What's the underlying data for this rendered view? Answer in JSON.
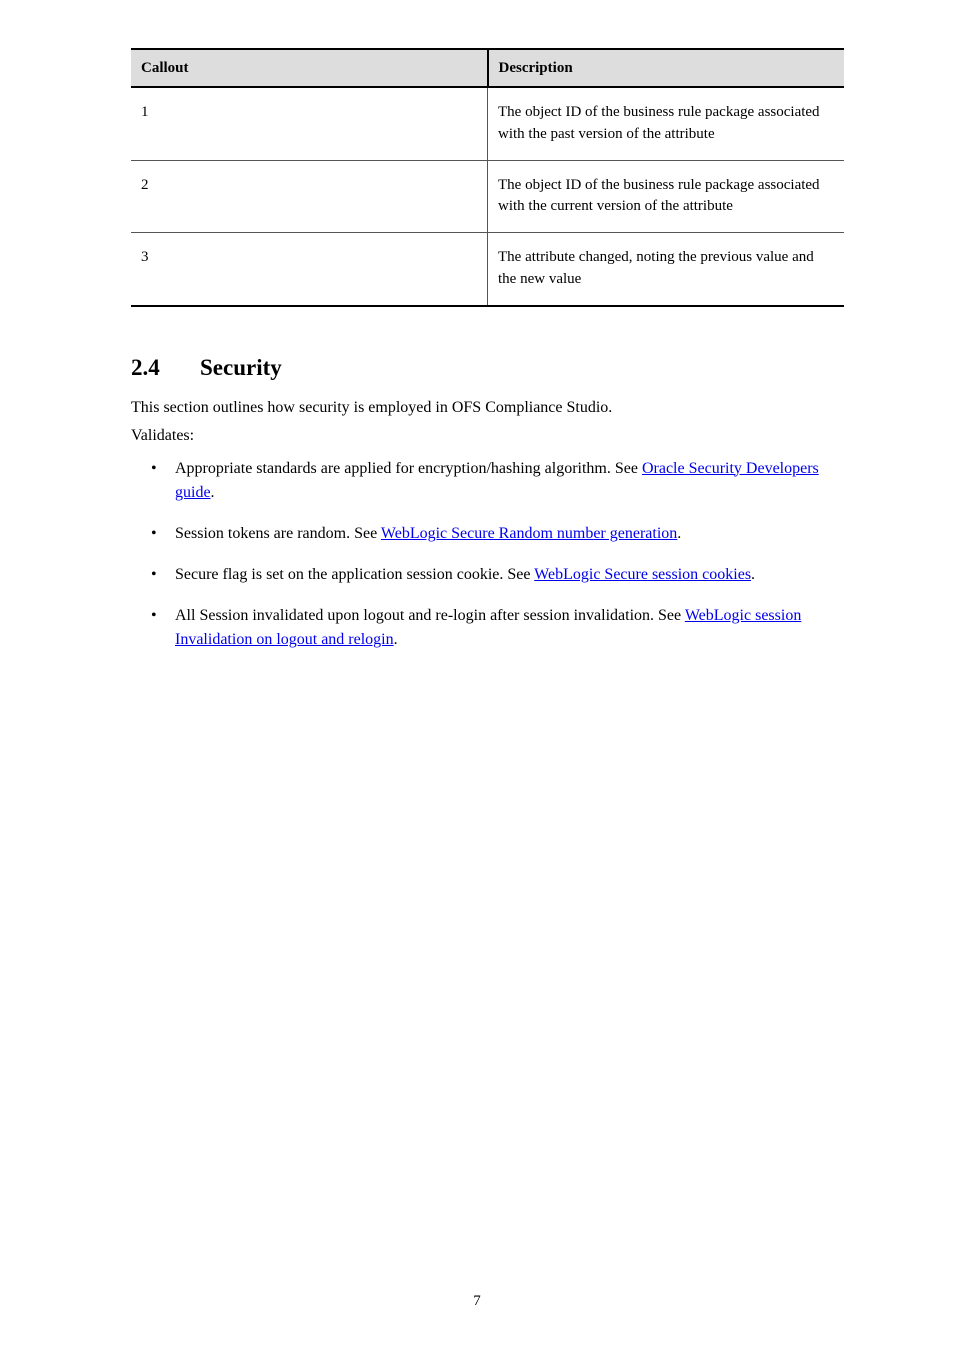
{
  "table": {
    "headers": [
      "Callout",
      "Description"
    ],
    "rows": [
      {
        "callout": "1",
        "description": "The object ID of the business rule package associated with the past version of the attribute"
      },
      {
        "callout": "2",
        "description": "The object ID of the business rule package associated with the current version of the attribute"
      },
      {
        "callout": "3",
        "description": "The attribute changed, noting the previous value and the new value"
      }
    ]
  },
  "section": {
    "number": "2.4",
    "title": "Security"
  },
  "intro": "This section outlines how security is employed in OFS Compliance Studio.",
  "validates_label": "Validates:",
  "bullets": [
    {
      "text_before": "Appropriate standards are applied for encryption/hashing algorithm. See ",
      "link": "Oracle Security Developers guide",
      "text_after": "."
    },
    {
      "text_before": "Session tokens are random. See ",
      "link": "WebLogic Secure Random number generation",
      "text_after": "."
    },
    {
      "text_before": "Secure flag is set on the application session cookie. See ",
      "link": "WebLogic Secure session cookies",
      "text_after": "."
    },
    {
      "text_before": "All Session invalidated upon logout and re-login after session invalidation. See ",
      "link": "WebLogic session Invalidation on logout and relogin",
      "text_after": "."
    }
  ],
  "page_number": "7"
}
